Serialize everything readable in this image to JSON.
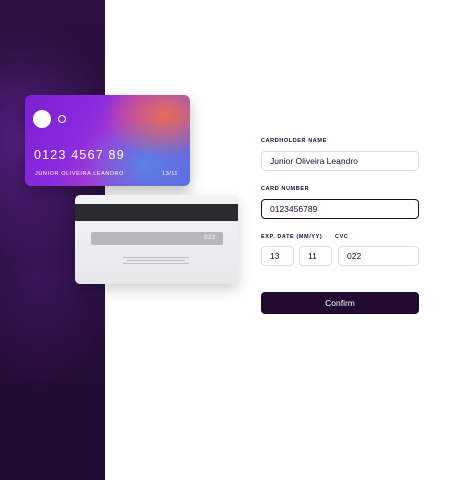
{
  "card_front": {
    "number": "0123 4567 89",
    "holder": "JUNIOR OLIVEIRA LEANDRO",
    "expiry": "13/11"
  },
  "card_back": {
    "cvc": "022"
  },
  "form": {
    "cardholder_label": "CARDHOLDER NAME",
    "cardholder_value": "Junior Oliveira Leandro",
    "card_number_label": "CARD NUMBER",
    "card_number_value": "0123456789",
    "exp_label": "EXP. DATE (MM/YY)",
    "exp_month_value": "13",
    "exp_year_value": "11",
    "cvc_label": "CVC",
    "cvc_value": "022",
    "confirm_label": "Confirm"
  },
  "colors": {
    "accent_dark": "#21092f",
    "input_border": "#dedde3"
  }
}
